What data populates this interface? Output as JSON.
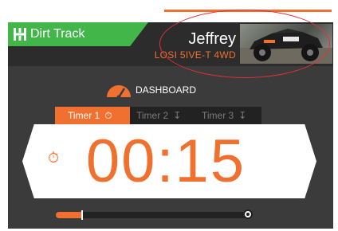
{
  "header": {
    "track_name": "Dirt Track",
    "track_icon": "grid-h-icon",
    "driver_name": "Jeffrey",
    "car_model": "LOSI 5IVE-T 4WD",
    "driver_photo": "rc-car-photo"
  },
  "dashboard": {
    "label": "DASHBOARD",
    "icon": "gauge-icon"
  },
  "timers": {
    "tabs": [
      {
        "label": "Timer 1",
        "icon": "stopwatch-icon",
        "active": true
      },
      {
        "label": "Timer 2",
        "icon": "count-up-icon",
        "active": false
      },
      {
        "label": "Timer 3",
        "icon": "count-up-icon",
        "active": false
      }
    ],
    "time": "00:15",
    "display_icon": "stopwatch-icon",
    "progress": 0.14
  },
  "colors": {
    "accent": "#f07030",
    "track_tab": "#43b649",
    "background": "#3b3b3b",
    "header": "#2c2c2c"
  }
}
